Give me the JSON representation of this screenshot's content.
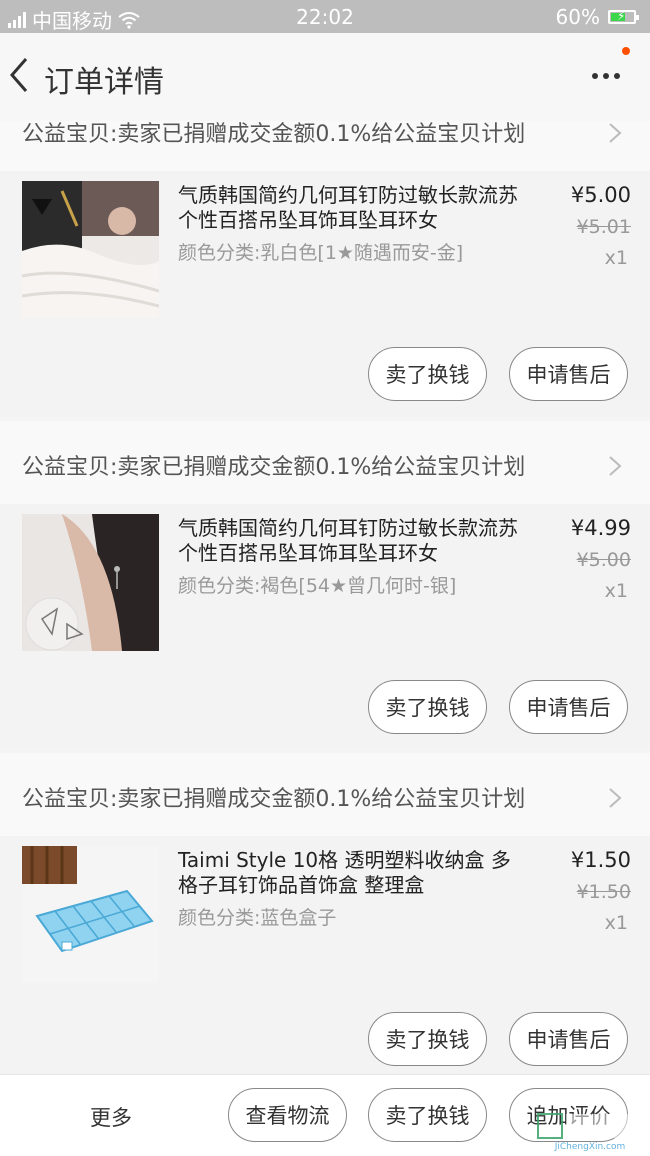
{
  "status_bar": {
    "carrier": "中国移动",
    "time": "22:02",
    "battery": "60%"
  },
  "nav": {
    "title": "订单详情"
  },
  "charity_text": "公益宝贝:卖家已捐赠成交金额0.1%给公益宝贝计划",
  "items": [
    {
      "title": "气质韩国简约几何耳钉防过敏长款流苏个性百搭吊坠耳饰耳坠耳环女",
      "sku": "颜色分类:乳白色[1★随遇而安-金]",
      "price": "¥5.00",
      "orig_price": "¥5.01",
      "qty": "x1",
      "btn_sell": "卖了换钱",
      "btn_after": "申请售后"
    },
    {
      "title": "气质韩国简约几何耳钉防过敏长款流苏个性百搭吊坠耳饰耳坠耳环女",
      "sku": "颜色分类:褐色[54★曾几何时-银]",
      "price": "¥4.99",
      "orig_price": "¥5.00",
      "qty": "x1",
      "btn_sell": "卖了换钱",
      "btn_after": "申请售后"
    },
    {
      "title": "Taimi Style 10格 透明塑料收纳盒 多格子耳钉饰品首饰盒 整理盒",
      "sku": "颜色分类:蓝色盒子",
      "price": "¥1.50",
      "orig_price": "¥1.50",
      "qty": "x1",
      "btn_sell": "卖了换钱",
      "btn_after": "申请售后"
    }
  ],
  "bottom_bar": {
    "more": "更多",
    "logistics": "查看物流",
    "sell": "卖了换钱",
    "review": "追加评价"
  },
  "watermark": "JiChengXin.com"
}
